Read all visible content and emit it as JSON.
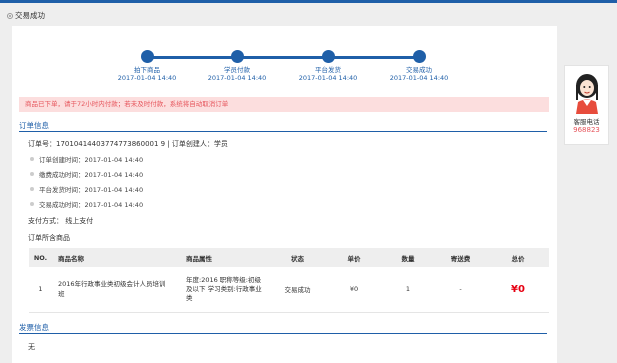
{
  "breadcrumb": {
    "label": "交易成功"
  },
  "steps": [
    {
      "label": "拍下商品",
      "time": "2017-01-04 14:40"
    },
    {
      "label": "学员付款",
      "time": "2017-01-04 14:40"
    },
    {
      "label": "平台发货",
      "time": "2017-01-04 14:40"
    },
    {
      "label": "交易成功",
      "time": "2017-01-04 14:40"
    }
  ],
  "alert": "商品已下单，请于72小时内付款；若未及时付款，系统将自动取消订单",
  "order_section": {
    "title": "订单信息",
    "order_line": "订单号：17010414403774773860001 9 | 订单创建人：学员",
    "timeline": [
      "订单创建时间：2017-01-04 14:40",
      "缴费成功时间：2017-01-04 14:40",
      "平台发货时间：2017-01-04 14:40",
      "交易成功时间：2017-01-04 14:40"
    ],
    "payment": "支付方式：  线上支付",
    "goods_label": "订单所含商品"
  },
  "table": {
    "headers": [
      "NO.",
      "商品名称",
      "商品属性",
      "状态",
      "单价",
      "数量",
      "寄送费",
      "总价"
    ],
    "rows": [
      {
        "no": "1",
        "name": "2016年行政事业类初级会计人员培训班",
        "attrs": "年度:2016 职称等级:初级及以下 学习类别:行政事业类",
        "status": "交易成功",
        "unit_price": "¥0",
        "qty": "1",
        "shipping": "-",
        "total": "¥0"
      }
    ]
  },
  "invoice_section": {
    "title": "发票信息",
    "value": "无"
  },
  "side_widget": {
    "label": "客服电话",
    "number": "968823"
  },
  "colors": {
    "accent": "#1f5fa8",
    "alert_bg": "#fcdede",
    "alert_text": "#e6555c",
    "price": "#e60012"
  }
}
